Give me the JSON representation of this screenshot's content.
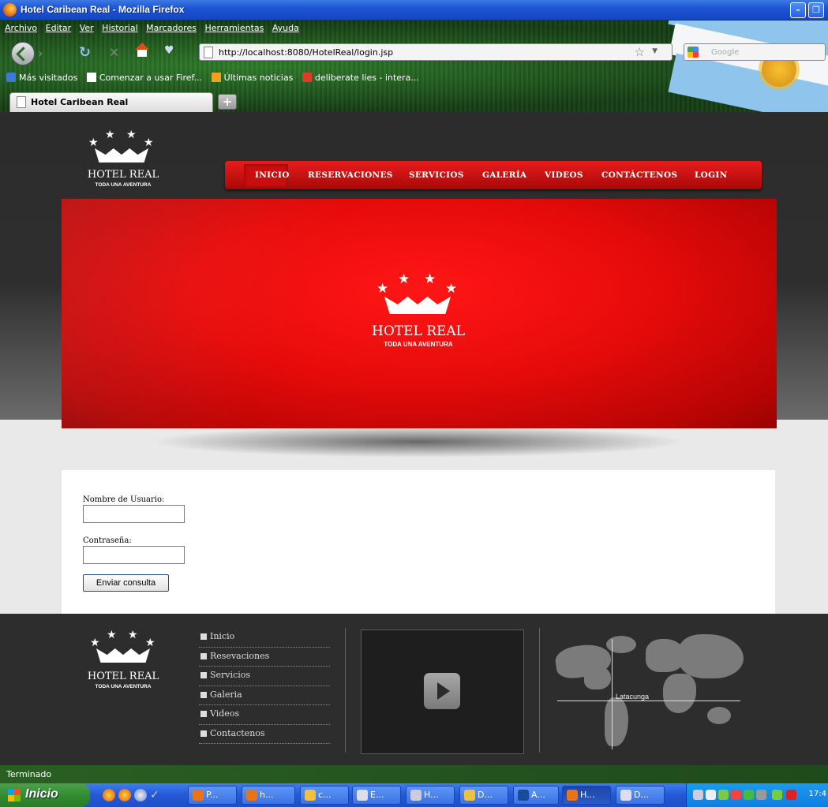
{
  "window": {
    "title": "Hotel Caribean Real - Mozilla Firefox"
  },
  "menu": [
    "Archivo",
    "Editar",
    "Ver",
    "Historial",
    "Marcadores",
    "Herramientas",
    "Ayuda"
  ],
  "address": {
    "url": "http://localhost:8080/HotelReal/login.jsp"
  },
  "search": {
    "placeholder": "Google"
  },
  "bookmarks": [
    "Más visitados",
    "Comenzar a usar Firef...",
    "Últimas noticias",
    "deliberate lies - intera..."
  ],
  "tab": {
    "title": "Hotel Caribean Real",
    "new_tab": "+"
  },
  "site": {
    "logo_title": "HOTEL REAL",
    "logo_sub": "TODA UNA AVENTURA",
    "nav": [
      "INICIO",
      "RESERVACIONES",
      "SERVICIOS",
      "GALERÍA",
      "VIDEOS",
      "CONTÁCTENOS",
      "LOGIN"
    ],
    "active_nav": "INICIO"
  },
  "form": {
    "user_label": "Nombre de Usuario:",
    "password_label": "Contraseña:",
    "user_value": "",
    "password_value": "",
    "submit_label": "Enviar consulta"
  },
  "footer": {
    "links": [
      "Inicio",
      "Resevaciones",
      "Servicios",
      "Galeria",
      "Videos",
      "Contactenos"
    ],
    "map_city": "Latacunga"
  },
  "status": {
    "text": "Terminado"
  },
  "taskbar": {
    "start_label": "Inicio",
    "buttons": [
      "P...",
      "h...",
      "c...",
      "E...",
      "H...",
      "D...",
      "A...",
      "H...",
      "D..."
    ],
    "time": "17:4"
  }
}
